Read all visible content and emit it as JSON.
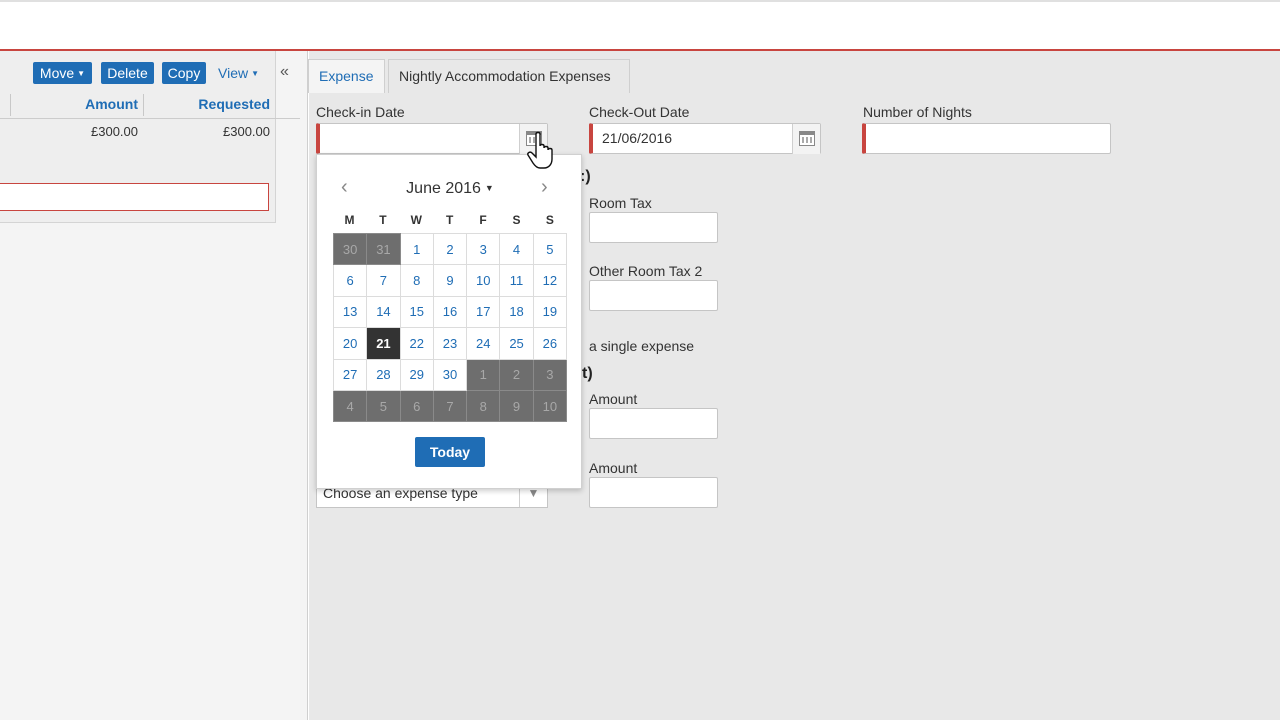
{
  "toolbar": {
    "move_label": "Move",
    "delete_label": "Delete",
    "copy_label": "Copy",
    "view_label": "View",
    "collapse_label": "«"
  },
  "list": {
    "columns": [
      "Amount",
      "Requested"
    ],
    "row": {
      "amount": "£300.00",
      "requested": "£300.00"
    }
  },
  "tabs": [
    "Expense",
    "Nightly Accommodation Expenses"
  ],
  "form": {
    "checkin_label": "Check-in Date",
    "checkin_value": "",
    "checkout_label": "Check-Out Date",
    "checkout_value": "21/06/2016",
    "nights_label": "Number of Nights",
    "nights_value": "",
    "room_tax_label": "Room Tax",
    "other_room_tax_label": "Other Room Tax 2",
    "single_expense_text": "a single expense",
    "amount_label_1": "Amount",
    "amount_label_2": "Amount",
    "expense_type_placeholder": "Choose an expense type"
  },
  "datepicker": {
    "month_label": "June 2016",
    "weekdays": [
      "M",
      "T",
      "W",
      "T",
      "F",
      "S",
      "S"
    ],
    "weeks": [
      [
        "30",
        "31",
        "1",
        "2",
        "3",
        "4",
        "5"
      ],
      [
        "6",
        "7",
        "8",
        "9",
        "10",
        "11",
        "12"
      ],
      [
        "13",
        "14",
        "15",
        "16",
        "17",
        "18",
        "19"
      ],
      [
        "20",
        "21",
        "22",
        "23",
        "24",
        "25",
        "26"
      ],
      [
        "27",
        "28",
        "29",
        "30",
        "1",
        "2",
        "3"
      ],
      [
        "4",
        "5",
        "6",
        "7",
        "8",
        "9",
        "10"
      ]
    ],
    "selected_day": "21",
    "today_label": "Today",
    "prev_icon": "‹",
    "next_icon": "›"
  },
  "colors": {
    "accent": "#1f6db5",
    "required": "#c8453f",
    "other_month": "#6e6e6e",
    "selected": "#333333"
  }
}
